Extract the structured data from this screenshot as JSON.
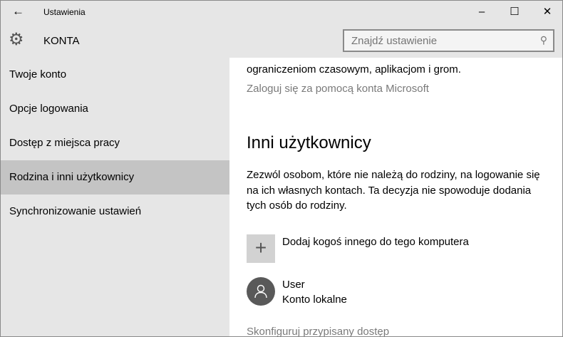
{
  "window": {
    "title": "Ustawienia",
    "back_icon": "arrow-left-icon",
    "minimize": "–",
    "maximize": "☐",
    "close": "✕"
  },
  "header": {
    "section": "KONTA",
    "icon": "gear-icon",
    "search_placeholder": "Znajdź ustawienie",
    "search_icon": "search-icon"
  },
  "sidebar": {
    "items": [
      {
        "label": "Twoje konto"
      },
      {
        "label": "Opcje logowania"
      },
      {
        "label": "Dostęp z miejsca pracy"
      },
      {
        "label": "Rodzina i inni użytkownicy",
        "active": true
      },
      {
        "label": "Synchronizowanie ustawień"
      }
    ]
  },
  "main": {
    "family_text": "ograniczeniom czasowym, aplikacjom i grom.",
    "ms_login_link": "Zaloguj się za pomocą konta Microsoft",
    "others_heading": "Inni użytkownicy",
    "others_desc": "Zezwól osobom, które nie należą do rodziny, na logowanie się na ich własnych kontach. Ta decyzja nie spowoduje dodania tych osób do rodziny.",
    "add_label": "Dodaj kogoś innego do tego komputera",
    "user": {
      "name": "User",
      "type": "Konto lokalne"
    },
    "assigned_access_link": "Skonfiguruj przypisany dostęp"
  }
}
